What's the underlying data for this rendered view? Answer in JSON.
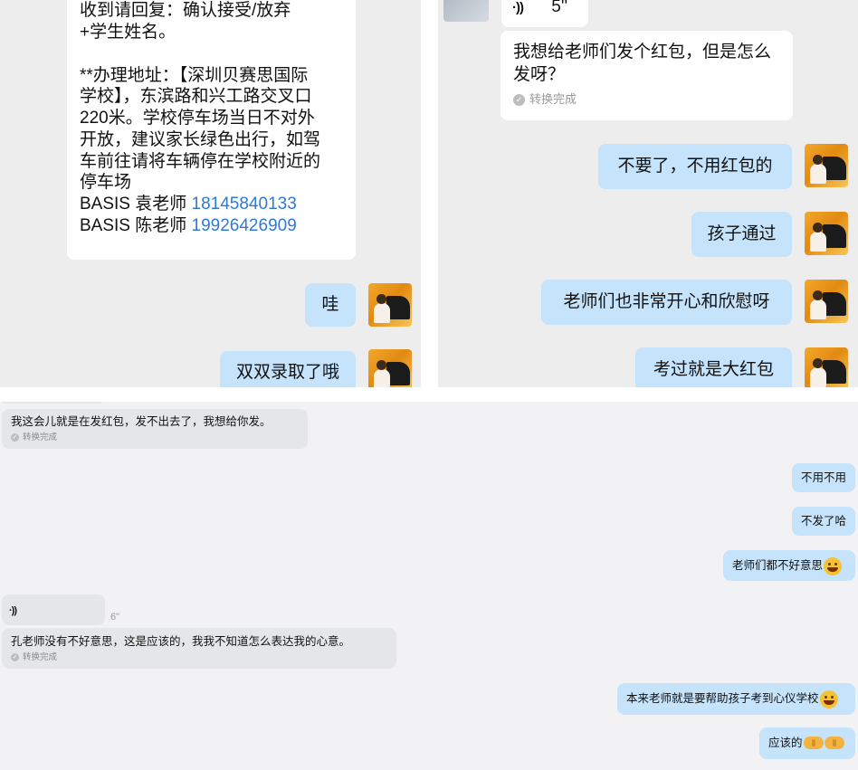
{
  "left_panel": {
    "notice_lines": [
      "收到请回复：确认接受/放弃",
      "+学生姓名。",
      "",
      "**办理地址：【深圳贝赛思国际",
      "学校】，东滨路和兴工路交叉口",
      "220米。学校停车场当日不对外",
      "开放，建议家长绿色出行，如驾",
      "车前往请将车辆停在学校附近的",
      "停车场"
    ],
    "contact_1": {
      "name": "BASIS 袁老师 ",
      "phone": "18145840133"
    },
    "contact_2": {
      "name": "BASIS 陈老师 ",
      "phone": "19926426909"
    },
    "msg_wa": "哇",
    "msg_admitted": "双双录取了哦"
  },
  "right_panel": {
    "voice_duration": "5''",
    "msg_question": "我想给老师们发个红包，但是怎么发呀？",
    "converted_label": "转换完成",
    "msg_no_need": "不要了，不用红包的",
    "msg_passed": "孩子通过",
    "msg_happy": "老师们也非常开心和欣慰呀",
    "msg_big_red": "考过就是大红包"
  },
  "bottom_panel": {
    "msg_sending": "我这会儿就是在发红包，发不出去了，我想给你发。",
    "converted_label": "转换完成",
    "msg_no_no": "不用不用",
    "msg_not_sent": "不发了哈",
    "msg_embarrassed": "老师们都不好意思",
    "voice_duration": "6\"",
    "msg_teacher_kong": "孔老师没有不好意思，这是应该的，我我不知道怎么表达我的心意。",
    "msg_help": "本来老师就是要帮助孩子考到心仪学校",
    "msg_should": "应该的",
    "emoji_names": [
      "crying-laughing-emoji",
      "grinning-emoji",
      "handshake-emoji"
    ]
  },
  "colors": {
    "sent_bubble": "#c5e3fb",
    "received_bubble": "#ffffff",
    "link": "#2f79d6",
    "panel_bg": "#ededed"
  }
}
